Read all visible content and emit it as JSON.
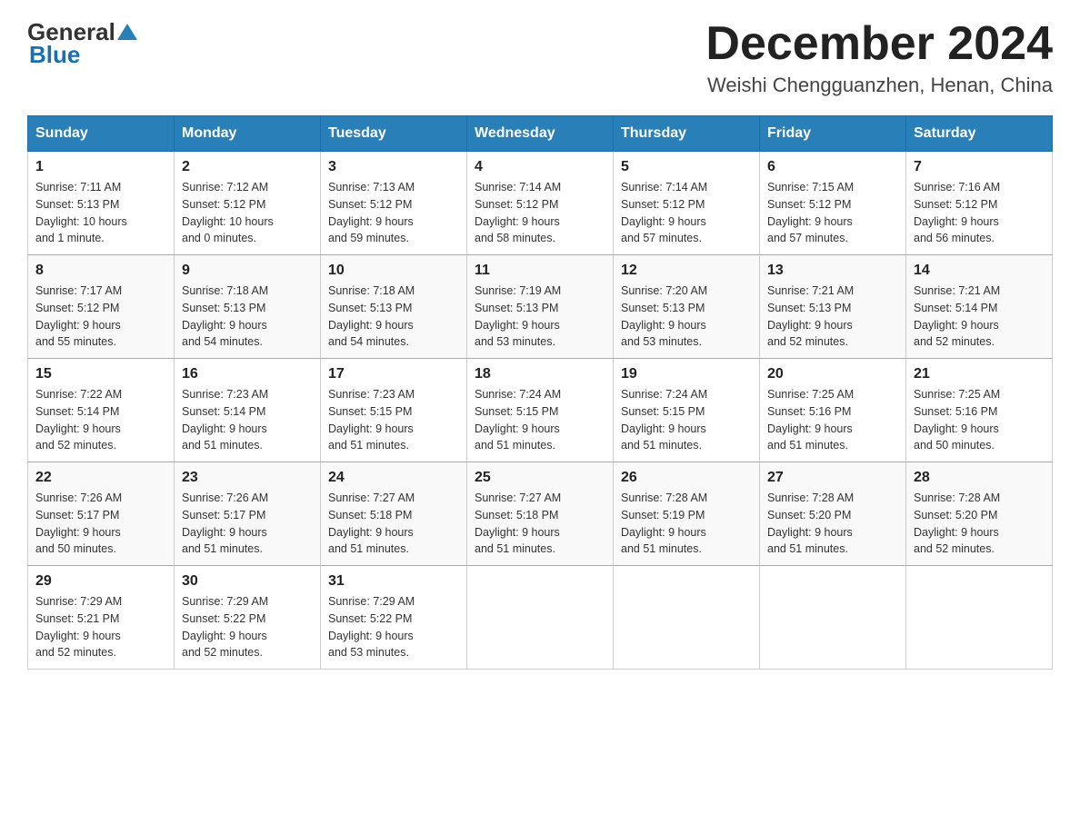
{
  "header": {
    "logo": {
      "general": "General",
      "blue": "Blue"
    },
    "title": "December 2024",
    "location": "Weishi Chengguanzhen, Henan, China"
  },
  "days_of_week": [
    "Sunday",
    "Monday",
    "Tuesday",
    "Wednesday",
    "Thursday",
    "Friday",
    "Saturday"
  ],
  "weeks": [
    [
      {
        "day": "1",
        "sunrise": "7:11 AM",
        "sunset": "5:13 PM",
        "daylight": "10 hours and 1 minute."
      },
      {
        "day": "2",
        "sunrise": "7:12 AM",
        "sunset": "5:12 PM",
        "daylight": "10 hours and 0 minutes."
      },
      {
        "day": "3",
        "sunrise": "7:13 AM",
        "sunset": "5:12 PM",
        "daylight": "9 hours and 59 minutes."
      },
      {
        "day": "4",
        "sunrise": "7:14 AM",
        "sunset": "5:12 PM",
        "daylight": "9 hours and 58 minutes."
      },
      {
        "day": "5",
        "sunrise": "7:14 AM",
        "sunset": "5:12 PM",
        "daylight": "9 hours and 57 minutes."
      },
      {
        "day": "6",
        "sunrise": "7:15 AM",
        "sunset": "5:12 PM",
        "daylight": "9 hours and 57 minutes."
      },
      {
        "day": "7",
        "sunrise": "7:16 AM",
        "sunset": "5:12 PM",
        "daylight": "9 hours and 56 minutes."
      }
    ],
    [
      {
        "day": "8",
        "sunrise": "7:17 AM",
        "sunset": "5:12 PM",
        "daylight": "9 hours and 55 minutes."
      },
      {
        "day": "9",
        "sunrise": "7:18 AM",
        "sunset": "5:13 PM",
        "daylight": "9 hours and 54 minutes."
      },
      {
        "day": "10",
        "sunrise": "7:18 AM",
        "sunset": "5:13 PM",
        "daylight": "9 hours and 54 minutes."
      },
      {
        "day": "11",
        "sunrise": "7:19 AM",
        "sunset": "5:13 PM",
        "daylight": "9 hours and 53 minutes."
      },
      {
        "day": "12",
        "sunrise": "7:20 AM",
        "sunset": "5:13 PM",
        "daylight": "9 hours and 53 minutes."
      },
      {
        "day": "13",
        "sunrise": "7:21 AM",
        "sunset": "5:13 PM",
        "daylight": "9 hours and 52 minutes."
      },
      {
        "day": "14",
        "sunrise": "7:21 AM",
        "sunset": "5:14 PM",
        "daylight": "9 hours and 52 minutes."
      }
    ],
    [
      {
        "day": "15",
        "sunrise": "7:22 AM",
        "sunset": "5:14 PM",
        "daylight": "9 hours and 52 minutes."
      },
      {
        "day": "16",
        "sunrise": "7:23 AM",
        "sunset": "5:14 PM",
        "daylight": "9 hours and 51 minutes."
      },
      {
        "day": "17",
        "sunrise": "7:23 AM",
        "sunset": "5:15 PM",
        "daylight": "9 hours and 51 minutes."
      },
      {
        "day": "18",
        "sunrise": "7:24 AM",
        "sunset": "5:15 PM",
        "daylight": "9 hours and 51 minutes."
      },
      {
        "day": "19",
        "sunrise": "7:24 AM",
        "sunset": "5:15 PM",
        "daylight": "9 hours and 51 minutes."
      },
      {
        "day": "20",
        "sunrise": "7:25 AM",
        "sunset": "5:16 PM",
        "daylight": "9 hours and 51 minutes."
      },
      {
        "day": "21",
        "sunrise": "7:25 AM",
        "sunset": "5:16 PM",
        "daylight": "9 hours and 50 minutes."
      }
    ],
    [
      {
        "day": "22",
        "sunrise": "7:26 AM",
        "sunset": "5:17 PM",
        "daylight": "9 hours and 50 minutes."
      },
      {
        "day": "23",
        "sunrise": "7:26 AM",
        "sunset": "5:17 PM",
        "daylight": "9 hours and 51 minutes."
      },
      {
        "day": "24",
        "sunrise": "7:27 AM",
        "sunset": "5:18 PM",
        "daylight": "9 hours and 51 minutes."
      },
      {
        "day": "25",
        "sunrise": "7:27 AM",
        "sunset": "5:18 PM",
        "daylight": "9 hours and 51 minutes."
      },
      {
        "day": "26",
        "sunrise": "7:28 AM",
        "sunset": "5:19 PM",
        "daylight": "9 hours and 51 minutes."
      },
      {
        "day": "27",
        "sunrise": "7:28 AM",
        "sunset": "5:20 PM",
        "daylight": "9 hours and 51 minutes."
      },
      {
        "day": "28",
        "sunrise": "7:28 AM",
        "sunset": "5:20 PM",
        "daylight": "9 hours and 52 minutes."
      }
    ],
    [
      {
        "day": "29",
        "sunrise": "7:29 AM",
        "sunset": "5:21 PM",
        "daylight": "9 hours and 52 minutes."
      },
      {
        "day": "30",
        "sunrise": "7:29 AM",
        "sunset": "5:22 PM",
        "daylight": "9 hours and 52 minutes."
      },
      {
        "day": "31",
        "sunrise": "7:29 AM",
        "sunset": "5:22 PM",
        "daylight": "9 hours and 53 minutes."
      },
      null,
      null,
      null,
      null
    ]
  ]
}
